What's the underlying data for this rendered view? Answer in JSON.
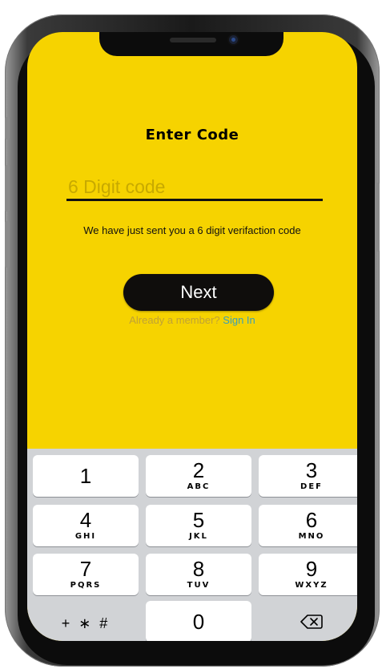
{
  "screen": {
    "title": "Enter Code",
    "code_placeholder": "6 Digit code",
    "info_text": "We have just sent you a 6 digit verifaction code",
    "next_label": "Next",
    "member_prompt": "Already a member?",
    "signin_label": "Sign In"
  },
  "keypad": {
    "keys": [
      {
        "digit": "1",
        "letters": ""
      },
      {
        "digit": "2",
        "letters": "ABC"
      },
      {
        "digit": "3",
        "letters": "DEF"
      },
      {
        "digit": "4",
        "letters": "GHI"
      },
      {
        "digit": "5",
        "letters": "JKL"
      },
      {
        "digit": "6",
        "letters": "MNO"
      },
      {
        "digit": "7",
        "letters": "PQRS"
      },
      {
        "digit": "8",
        "letters": "TUV"
      },
      {
        "digit": "9",
        "letters": "WXYZ"
      },
      {
        "symbols": "+ ∗ #"
      },
      {
        "digit": "0",
        "letters": ""
      },
      {
        "icon": "backspace-icon"
      }
    ]
  },
  "colors": {
    "background": "#f6d300",
    "button": "#0f0d0c",
    "link": "#3a9fb7"
  }
}
